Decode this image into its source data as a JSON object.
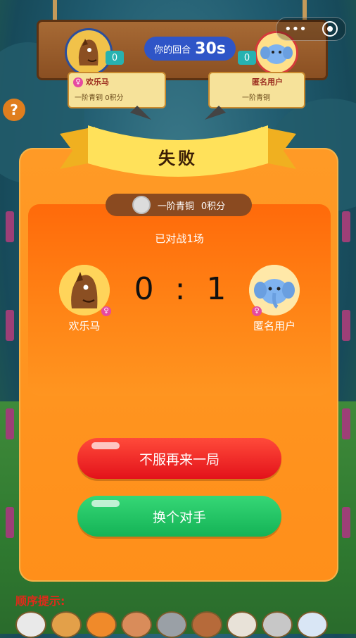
{
  "top_bar": {
    "turn_label": "你的回合",
    "turn_timer": "30s",
    "left_player": {
      "name": "欢乐马",
      "rank": "一阶青铜",
      "points": "0积分",
      "gem_count": "0"
    },
    "right_player": {
      "name": "匿名用户",
      "rank": "一阶青铜",
      "gem_count": "0"
    }
  },
  "side": {
    "help_label": "?"
  },
  "result_modal": {
    "title": "失败",
    "rank_text": "一阶青铜",
    "points_text": "0积分",
    "battles_played": "已对战1场",
    "score": "0 : 1",
    "left_player_name": "欢乐马",
    "right_player_name": "匿名用户",
    "rematch_label": "不服再来一局",
    "change_opponent_label": "换个对手"
  },
  "bottom": {
    "order_hint_label": "顺序提示:"
  },
  "colors": {
    "modal_orange": "#ff9a26",
    "red_button": "#e3121a",
    "green_button": "#14b356"
  }
}
